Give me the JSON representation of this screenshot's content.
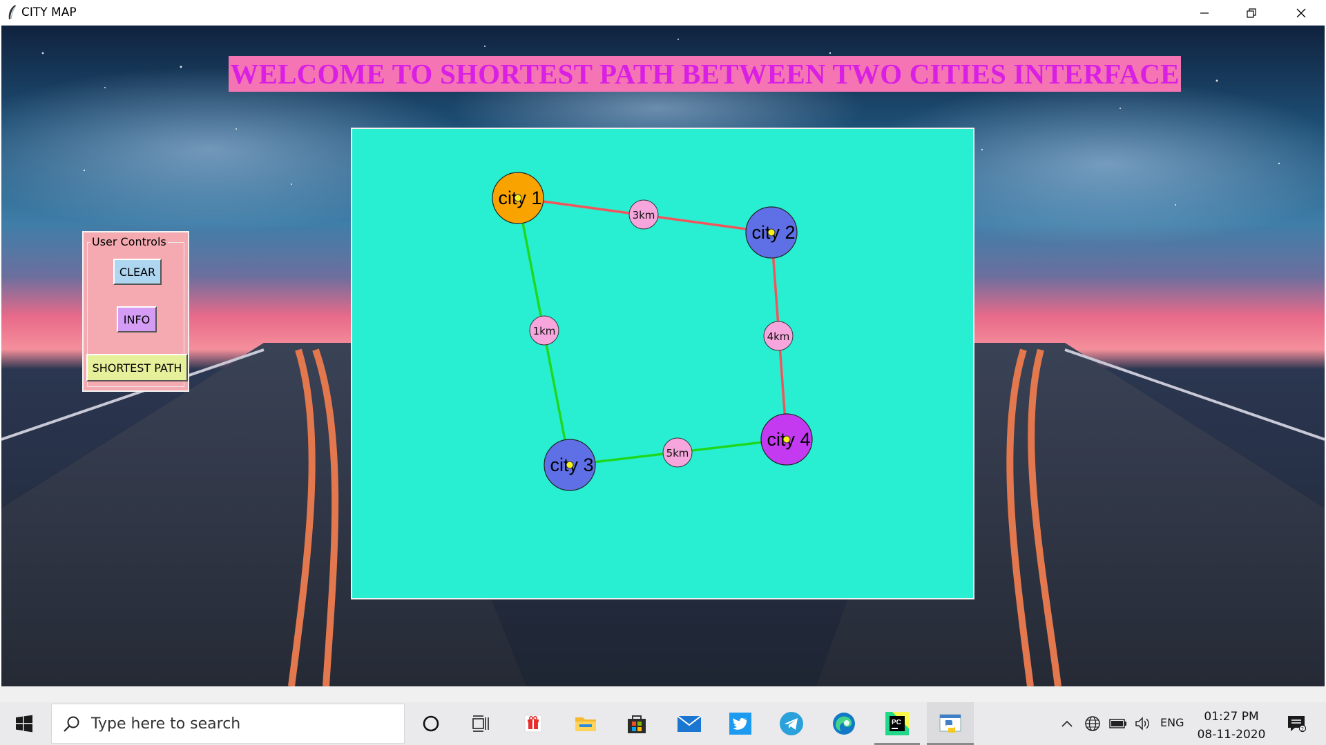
{
  "window": {
    "title": "CITY MAP"
  },
  "banner": {
    "text": "WELCOME TO SHORTEST PATH BETWEEN TWO CITIES INTERFACE"
  },
  "controls": {
    "legend": "User Controls",
    "clear_label": "CLEAR",
    "info_label": "INFO",
    "shortest_path_label": "SHORTEST PATH"
  },
  "map": {
    "cities": [
      {
        "id": "1",
        "label": "city 1",
        "color": "#f9a300"
      },
      {
        "id": "2",
        "label": "city 2",
        "color": "#5f6fe6"
      },
      {
        "id": "3",
        "label": "city 3",
        "color": "#5f6fe6"
      },
      {
        "id": "4",
        "label": "city 4",
        "color": "#c43af0"
      }
    ],
    "roads": [
      {
        "from": "1",
        "to": "2",
        "distance": "3km",
        "on_shortest_path": false,
        "color": "#f2545b"
      },
      {
        "from": "2",
        "to": "4",
        "distance": "4km",
        "on_shortest_path": false,
        "color": "#f2545b"
      },
      {
        "from": "1",
        "to": "3",
        "distance": "1km",
        "on_shortest_path": true,
        "color": "#1ed81e"
      },
      {
        "from": "3",
        "to": "4",
        "distance": "5km",
        "on_shortest_path": true,
        "color": "#1ed81e"
      }
    ],
    "canvas_color": "#29efd2",
    "distance_label_color": "#f7a6dd",
    "node_marker_color": "#f6f21a"
  },
  "taskbar": {
    "search_placeholder": "Type here to search",
    "language": "ENG",
    "time": "01:27 PM",
    "date": "08-11-2020",
    "pinned": [
      "start-icon",
      "cortana-icon",
      "task-view-icon",
      "gift-icon",
      "file-explorer-icon",
      "store-icon",
      "mail-icon",
      "twitter-icon",
      "telegram-icon",
      "edge-icon",
      "pycharm-icon",
      "python-icon"
    ],
    "tray": [
      "chevron-up-icon",
      "network-icon",
      "battery-icon",
      "volume-icon",
      "notification-icon"
    ]
  }
}
